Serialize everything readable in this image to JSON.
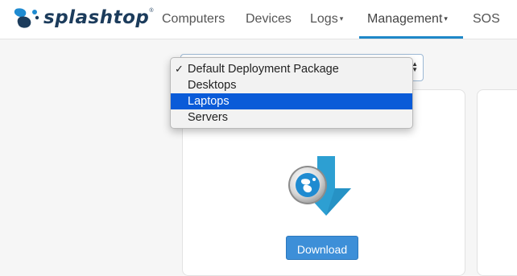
{
  "brand": {
    "name": "splashtop",
    "reg_mark": "®"
  },
  "nav": {
    "items": [
      {
        "label": "Computers",
        "has_caret": false
      },
      {
        "label": "Devices",
        "has_caret": false
      },
      {
        "label": "Logs",
        "has_caret": true
      },
      {
        "label": "Management",
        "has_caret": true,
        "active": true
      },
      {
        "label": "SOS",
        "has_caret": false
      }
    ],
    "caret_glyph": "▾"
  },
  "select": {
    "selected_value": "Default Deployment Package",
    "options": [
      "Default Deployment Package",
      "Desktops",
      "Laptops",
      "Servers"
    ],
    "checked": "Default Deployment Package",
    "highlighted": "Laptops",
    "check_glyph": "✓"
  },
  "download": {
    "button_label": "Download",
    "icon": "splashtop-download-icon"
  },
  "colors": {
    "accent": "#1e88c8",
    "highlight": "#0a5bd8",
    "button": "#3d8fd8",
    "arrow": "#2d9fd2",
    "brand_dark": "#1c3c5c"
  }
}
